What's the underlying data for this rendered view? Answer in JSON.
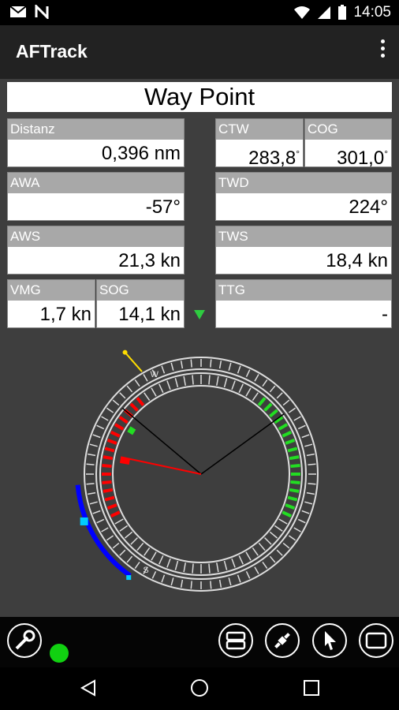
{
  "status": {
    "time": "14:05"
  },
  "app": {
    "title": "AFTrack"
  },
  "header": {
    "label": "Way Point"
  },
  "fields": {
    "distanz": {
      "label": "Distanz",
      "value": "0,396 nm"
    },
    "ctw": {
      "label": "CTW",
      "value": "283,8",
      "unit": "°"
    },
    "cog": {
      "label": "COG",
      "value": "301,0",
      "unit": "°"
    },
    "awa": {
      "label": "AWA",
      "value": "-57°"
    },
    "twd": {
      "label": "TWD",
      "value": "224°"
    },
    "aws": {
      "label": "AWS",
      "value": "21,3 kn"
    },
    "tws": {
      "label": "TWS",
      "value": "18,4 kn"
    },
    "vmg": {
      "label": "VMG",
      "value": "1,7 kn"
    },
    "sog": {
      "label": "SOG",
      "value": "14,1 kn"
    },
    "ttg": {
      "label": "TTG",
      "value": "-"
    }
  },
  "compass": {
    "letters": [
      "W",
      "S"
    ],
    "colors": {
      "port": "#ff0000",
      "starboard": "#22dd22",
      "accent": "#0000ff",
      "cyan": "#00ccff",
      "yellow": "#ffdd00"
    }
  },
  "icons": [
    "wrench-icon",
    "layout-icon",
    "satellite-icon",
    "cursor-icon",
    "screen-icon"
  ]
}
